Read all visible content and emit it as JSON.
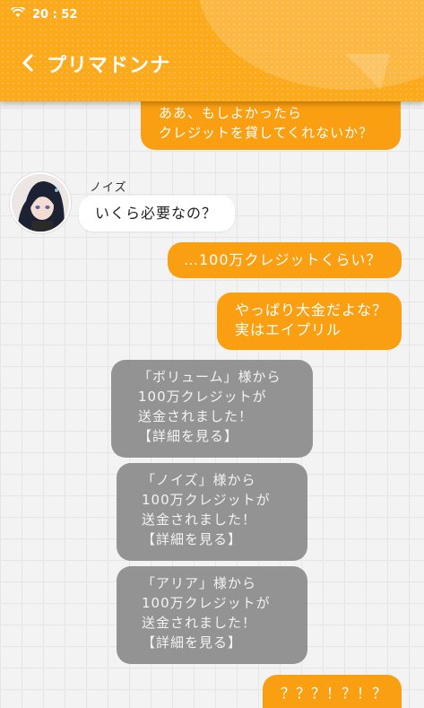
{
  "status": {
    "time": "20 : 52"
  },
  "header": {
    "title": "プリマドンナ"
  },
  "messages": {
    "m1_line1": "ああ、もしよかったら",
    "m1_line2": "クレジットを貸してくれないか？",
    "sender_name": "ノイズ",
    "m2": "いくら必要なの？",
    "m3": "…100万クレジットくらい？",
    "m4_line1": "やっぱり大金だよな？",
    "m4_line2": "実はエイプリル",
    "s1": [
      "「ボリューム」様から",
      "100万クレジットが",
      "送金されました！",
      "【詳細を見る】"
    ],
    "s2": [
      "「ノイズ」様から",
      "100万クレジットが",
      "送金されました！",
      "【詳細を見る】"
    ],
    "s3": [
      "「アリア」様から",
      "100万クレジットが",
      "送金されました！",
      "【詳細を見る】"
    ],
    "m5": "？？？！？！？"
  },
  "colors": {
    "accent": "#fbaa1c",
    "bubble_out": "#fb9f12",
    "system": "#8e8e8e"
  }
}
